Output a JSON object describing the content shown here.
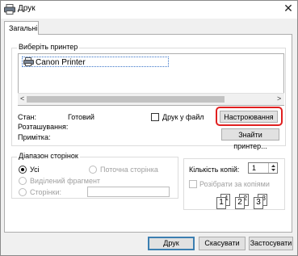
{
  "window": {
    "title": "Друк",
    "icon": "printer-icon"
  },
  "tabs": [
    {
      "label": "Загальні"
    }
  ],
  "printer_group": {
    "label": "Виберіть принтер",
    "printers": [
      {
        "name": "Canon Printer",
        "selected": true
      }
    ],
    "status_label": "Стан:",
    "status_value": "Готовий",
    "location_label": "Розташування:",
    "comment_label": "Примітка:",
    "print_to_file_label": "Друк у файл",
    "preferences_button": "Настроювання",
    "find_printer_button": "Знайти принтер..."
  },
  "page_range": {
    "label": "Діапазон сторінок",
    "all_label": "Усі",
    "current_page_label": "Поточна сторінка",
    "selection_label": "Виділений фрагмент",
    "pages_label": "Сторінки:",
    "pages_value": ""
  },
  "copies": {
    "label": "Кількість копій:",
    "value": "1",
    "collate_label": "Розібрати за копіями",
    "collate_icon_pages": [
      "1",
      "1",
      "2",
      "2",
      "3",
      "3"
    ]
  },
  "footer": {
    "print_button": "Друк",
    "cancel_button": "Скасувати",
    "apply_button": "Застосувати"
  },
  "colors": {
    "highlight_ring": "#e02020",
    "selection_border": "#3a74c8",
    "default_button_border": "#3c7fb1"
  }
}
